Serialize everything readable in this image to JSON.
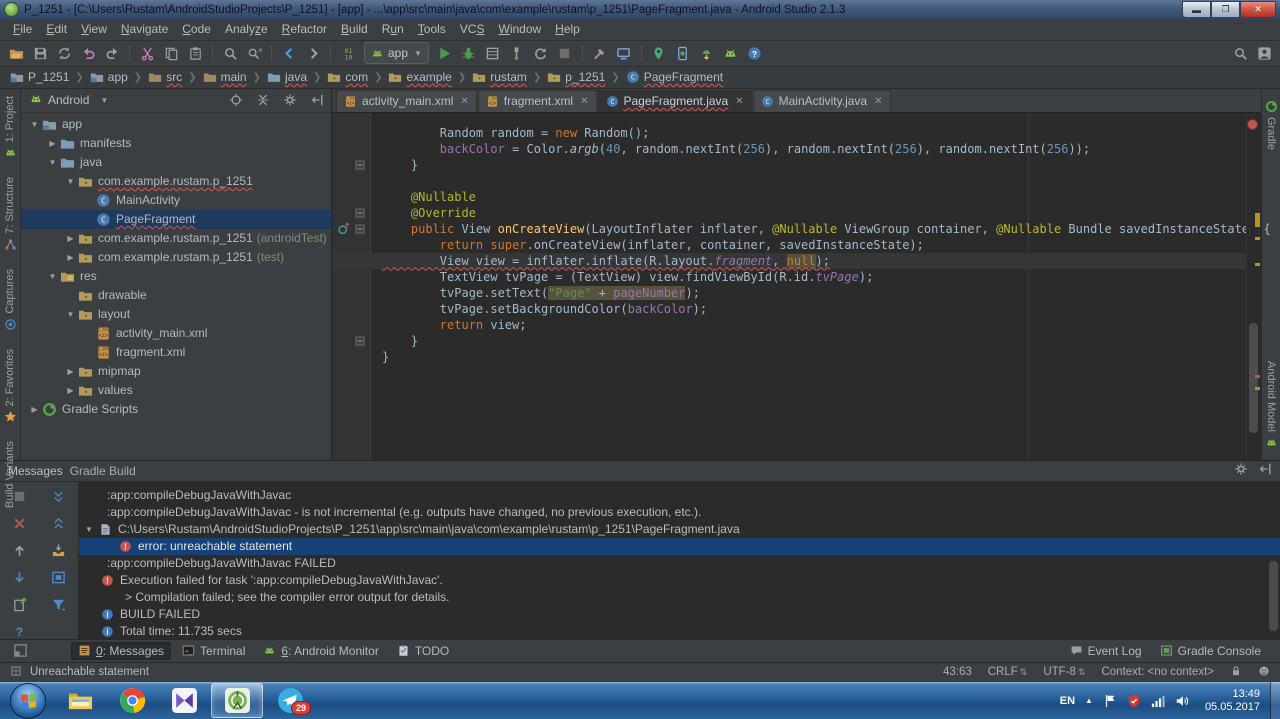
{
  "window": {
    "title": "P_1251 - [C:\\Users\\Rustam\\AndroidStudioProjects\\P_1251] - [app] - ...\\app\\src\\main\\java\\com\\example\\rustam\\p_1251\\PageFragment.java - Android Studio 2.1.3"
  },
  "colors": {
    "panel_bg": "#3C3F41",
    "editor_bg": "#2B2B2B",
    "selection_blue": "#154176",
    "tree_selection": "#1e3a5c",
    "error_red": "#C75450",
    "android_green": "#57A64A",
    "keyword_orange": "#CC7832",
    "accent_blue": "#4A88C7"
  },
  "menu": {
    "items": [
      {
        "label": "File",
        "u": 0
      },
      {
        "label": "Edit",
        "u": 0
      },
      {
        "label": "View",
        "u": 0
      },
      {
        "label": "Navigate",
        "u": 0
      },
      {
        "label": "Code",
        "u": 0
      },
      {
        "label": "Analyze",
        "u": 5
      },
      {
        "label": "Refactor",
        "u": 0
      },
      {
        "label": "Build",
        "u": 0
      },
      {
        "label": "Run",
        "u": 1
      },
      {
        "label": "Tools",
        "u": 0
      },
      {
        "label": "VCS",
        "u": 2
      },
      {
        "label": "Window",
        "u": 0
      },
      {
        "label": "Help",
        "u": 0
      }
    ]
  },
  "toolbar": {
    "run_config": "app",
    "items": [
      "open",
      "save",
      "sync",
      "undo",
      "redo",
      "|",
      "cut",
      "copy",
      "paste",
      "|",
      "find",
      "replace",
      "|",
      "back",
      "forward",
      "|",
      "binary",
      "combo",
      "run",
      "debug",
      "coverage",
      "attach",
      "restart",
      "stop",
      "|",
      "tools",
      "devices",
      "|",
      "pin",
      "avd",
      "sdk",
      "droid",
      "help"
    ],
    "right_items": [
      "search",
      "avatar"
    ]
  },
  "breadcrumbs": {
    "items": [
      {
        "label": "P_1251",
        "icon": "module",
        "error": false
      },
      {
        "label": "app",
        "icon": "module",
        "error": false
      },
      {
        "label": "src",
        "icon": "folder",
        "error": true
      },
      {
        "label": "main",
        "icon": "folder",
        "error": true
      },
      {
        "label": "java",
        "icon": "folderblue",
        "error": true
      },
      {
        "label": "com",
        "icon": "package",
        "error": true
      },
      {
        "label": "example",
        "icon": "package",
        "error": true
      },
      {
        "label": "rustam",
        "icon": "package",
        "error": true
      },
      {
        "label": "p_1251",
        "icon": "package",
        "error": true
      },
      {
        "label": "PageFragment",
        "icon": "class",
        "error": true
      }
    ]
  },
  "strips": {
    "left_top": [
      {
        "label": "1: Project",
        "icon": "droid"
      },
      {
        "label": "7: Structure",
        "icon": "structure"
      },
      {
        "label": "Captures",
        "icon": "captures"
      }
    ],
    "left_bottom": [
      {
        "label": "2: Favorites",
        "icon": "favorites"
      },
      {
        "label": "Build Variants",
        "icon": "droid"
      }
    ],
    "right_top": [
      {
        "label": "Gradle",
        "icon": "gradle"
      }
    ],
    "right_bottom": [
      {
        "label": "Android Model",
        "icon": "droid"
      }
    ]
  },
  "project": {
    "selector": "Android",
    "header_icons": [
      "target",
      "collapse",
      "gear",
      "hide"
    ],
    "tree": [
      {
        "label": "app",
        "level": 0,
        "arrow": "down",
        "icon": "module"
      },
      {
        "label": "manifests",
        "level": 1,
        "arrow": "right",
        "icon": "folderblue"
      },
      {
        "label": "java",
        "level": 1,
        "arrow": "down",
        "icon": "folderblue"
      },
      {
        "label": "com.example.rustam.p_1251",
        "level": 2,
        "arrow": "down",
        "icon": "package",
        "error": true
      },
      {
        "label": "MainActivity",
        "level": 3,
        "arrow": "none",
        "icon": "class"
      },
      {
        "label": "PageFragment",
        "level": 3,
        "arrow": "none",
        "icon": "class",
        "selected": true,
        "error": true
      },
      {
        "label": "com.example.rustam.p_1251",
        "suffix": "(androidTest)",
        "level": 2,
        "arrow": "right",
        "icon": "package"
      },
      {
        "label": "com.example.rustam.p_1251",
        "suffix": "(test)",
        "level": 2,
        "arrow": "right",
        "icon": "package"
      },
      {
        "label": "res",
        "level": 1,
        "arrow": "down",
        "icon": "res"
      },
      {
        "label": "drawable",
        "level": 2,
        "arrow": "none",
        "icon": "package"
      },
      {
        "label": "layout",
        "level": 2,
        "arrow": "down",
        "icon": "package"
      },
      {
        "label": "activity_main.xml",
        "level": 3,
        "arrow": "none",
        "icon": "xml"
      },
      {
        "label": "fragment.xml",
        "level": 3,
        "arrow": "none",
        "icon": "xml"
      },
      {
        "label": "mipmap",
        "level": 2,
        "arrow": "right",
        "icon": "package"
      },
      {
        "label": "values",
        "level": 2,
        "arrow": "right",
        "icon": "package"
      },
      {
        "label": "Gradle Scripts",
        "level": 0,
        "arrow": "right",
        "icon": "gradle"
      }
    ]
  },
  "editor": {
    "tabs": [
      {
        "label": "activity_main.xml",
        "icon": "xml",
        "selected": false,
        "error": false
      },
      {
        "label": "fragment.xml",
        "icon": "xml",
        "selected": false,
        "error": false
      },
      {
        "label": "PageFragment.java",
        "icon": "class",
        "selected": true,
        "error": true
      },
      {
        "label": "MainActivity.java",
        "icon": "class",
        "selected": false,
        "error": false
      }
    ],
    "code_lines": [
      {
        "tokens": [
          [
            "t",
            "        Random random = "
          ],
          [
            "k",
            "new"
          ],
          [
            "t",
            " Random();"
          ]
        ]
      },
      {
        "tokens": [
          [
            "t",
            "        "
          ],
          [
            "f",
            "backColor"
          ],
          [
            "t",
            " = Color."
          ],
          [
            "st",
            "argb"
          ],
          [
            "t",
            "("
          ],
          [
            "n",
            "40"
          ],
          [
            "t",
            ", random.nextInt("
          ],
          [
            "n",
            "256"
          ],
          [
            "t",
            "), random.nextInt("
          ],
          [
            "n",
            "256"
          ],
          [
            "t",
            "), random.nextInt("
          ],
          [
            "n",
            "256"
          ],
          [
            "t",
            "));"
          ]
        ]
      },
      {
        "tokens": [
          [
            "t",
            "    }"
          ]
        ]
      },
      {
        "tokens": []
      },
      {
        "tokens": [
          [
            "ann",
            "    @Nullable"
          ]
        ]
      },
      {
        "tokens": [
          [
            "ann",
            "    @Override"
          ]
        ]
      },
      {
        "tokens": [
          [
            "k",
            "    public"
          ],
          [
            "t",
            " View "
          ],
          [
            "m",
            "onCreateView"
          ],
          [
            "t",
            "(LayoutInflater inflater, "
          ],
          [
            "ann",
            "@Nullable"
          ],
          [
            "t",
            " ViewGroup container, "
          ],
          [
            "ann",
            "@Nullable"
          ],
          [
            "t",
            " Bundle savedInstanceState) {"
          ]
        ]
      },
      {
        "tokens": [
          [
            "k",
            "        return"
          ],
          [
            "t",
            " "
          ],
          [
            "k",
            "super"
          ],
          [
            "t",
            ".onCreateView(inflater, container, savedInstanceState);"
          ]
        ]
      },
      {
        "tokens": [
          [
            "t",
            "        View view = inflater.inflate(R.layout."
          ],
          [
            "it",
            "fragment"
          ],
          [
            "t",
            ", "
          ],
          [
            "k hl",
            "null"
          ],
          [
            "t",
            ");"
          ]
        ],
        "current": true,
        "error": true
      },
      {
        "tokens": [
          [
            "t",
            "        TextView tvPage = (TextView) view.findViewById(R.id."
          ],
          [
            "it",
            "tvPage"
          ],
          [
            "t",
            ");"
          ]
        ]
      },
      {
        "tokens": [
          [
            "t",
            "        tvPage.setText("
          ],
          [
            "s hl",
            "\"Page\""
          ],
          [
            "t hl",
            " + "
          ],
          [
            "f hl",
            "pageNumber"
          ],
          [
            "t",
            ");"
          ]
        ]
      },
      {
        "tokens": [
          [
            "t",
            "        tvPage.setBackgroundColor("
          ],
          [
            "f",
            "backColor"
          ],
          [
            "t",
            ");"
          ]
        ]
      },
      {
        "tokens": [
          [
            "k",
            "        return"
          ],
          [
            "t",
            " view;"
          ]
        ]
      },
      {
        "tokens": [
          [
            "t",
            "    }"
          ]
        ]
      },
      {
        "tokens": [
          [
            "t",
            "}"
          ]
        ]
      }
    ],
    "gutter_fold_lines": [
      3,
      6,
      7,
      14
    ],
    "override_line": 7
  },
  "messages": {
    "title1": "Messages",
    "title2": "Gradle Build",
    "toolbar": [
      "stopgray",
      "expandall",
      "closex",
      "collapseall",
      "arrup",
      "make",
      "arrdown",
      "preview",
      "export",
      "filter",
      "question"
    ],
    "rows": [
      {
        "pad": 28,
        "text": ":app:compileDebugJavaWithJavac"
      },
      {
        "pad": 28,
        "text": ":app:compileDebugJavaWithJavac - is not incremental (e.g. outputs have changed, no previous execution, etc.)."
      },
      {
        "pad": 6,
        "chev": true,
        "icon": "file",
        "text": "C:\\Users\\Rustam\\AndroidStudioProjects\\P_1251\\app\\src\\main\\java\\com\\example\\rustam\\p_1251\\PageFragment.java"
      },
      {
        "pad": 40,
        "icon": "error",
        "text": "error: unreachable statement",
        "selected": true
      },
      {
        "pad": 28,
        "text": ":app:compileDebugJavaWithJavac FAILED"
      },
      {
        "pad": 22,
        "icon": "error",
        "text": "Execution failed for task ':app:compileDebugJavaWithJavac'."
      },
      {
        "pad": 46,
        "text": "> Compilation failed; see the compiler error output for details."
      },
      {
        "pad": 22,
        "icon": "info",
        "text": "BUILD FAILED"
      },
      {
        "pad": 22,
        "icon": "info",
        "text": "Total time: 11.735 secs"
      }
    ]
  },
  "toolwindow_bar": {
    "left": [
      {
        "icon": "messages",
        "num": "0",
        "label": ": Messages",
        "active": true
      },
      {
        "icon": "terminal",
        "num": "",
        "label": "Terminal",
        "active": false
      },
      {
        "icon": "droid",
        "num": "6",
        "label": ": Android Monitor",
        "active": false
      },
      {
        "icon": "todo",
        "num": "",
        "label": "TODO",
        "active": false
      }
    ],
    "right": [
      {
        "icon": "eventlog",
        "label": "Event Log"
      },
      {
        "icon": "console",
        "label": "Gradle Console"
      }
    ]
  },
  "status_bar": {
    "message": "Unreachable statement",
    "position": "43:63",
    "line_ending": "CRLF",
    "encoding": "UTF-8",
    "context": "Context: <no context>"
  },
  "taskbar": {
    "lang": "EN",
    "time": "13:49",
    "date": "05.05.2017",
    "telegram_badge": "29"
  }
}
